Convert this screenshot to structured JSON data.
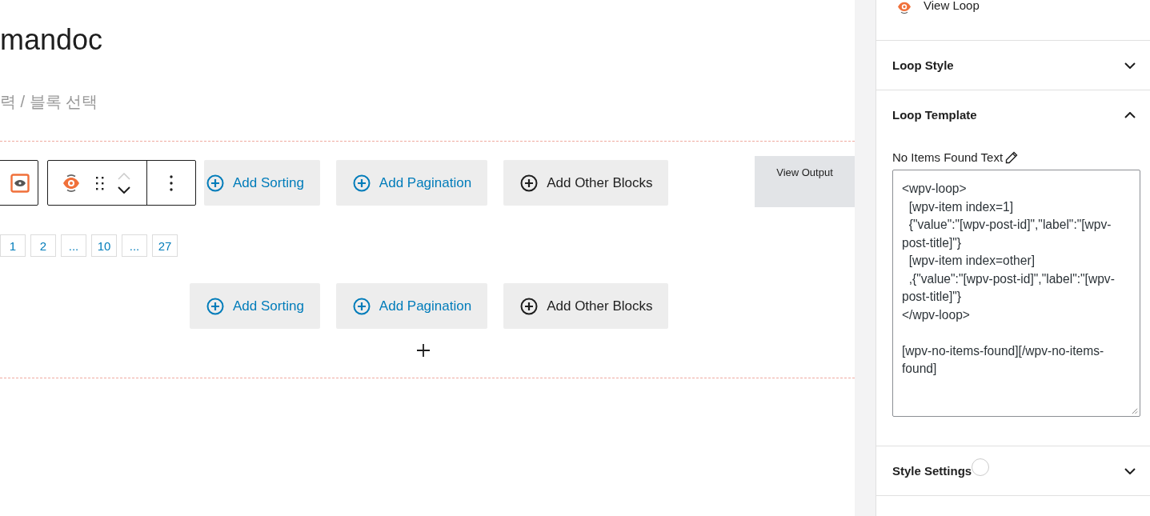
{
  "editor": {
    "title": "mandoc",
    "placeholder": "력 / 블록 선택",
    "top_buttons": [
      {
        "kind": "sorting",
        "label": "Add Sorting"
      },
      {
        "kind": "pagination",
        "label": "Add Pagination"
      },
      {
        "kind": "other",
        "label": "Add Other Blocks"
      }
    ],
    "pagination": [
      {
        "label": "1"
      },
      {
        "label": "2"
      },
      {
        "label": "..."
      },
      {
        "label": "10"
      },
      {
        "label": "..."
      },
      {
        "label": "27"
      }
    ],
    "bottom_buttons": [
      {
        "kind": "sorting",
        "label": "Add Sorting"
      },
      {
        "kind": "pagination",
        "label": "Add Pagination"
      },
      {
        "kind": "other",
        "label": "Add Other Blocks"
      }
    ],
    "view_output": "View Output"
  },
  "sidebar": {
    "view_loop": "View Loop",
    "panels": [
      {
        "title": "Loop Style",
        "expanded": false
      },
      {
        "title": "Loop Template",
        "expanded": true,
        "field_label": "No Items Found Text",
        "value": "<wpv-loop>\n  [wpv-item index=1]\n  {\"value\":\"[wpv-post-id]\",\"label\":\"[wpv-post-title]\"}\n  [wpv-item index=other]\n  ,{\"value\":\"[wpv-post-id]\",\"label\":\"[wpv-post-title]\"}\n</wpv-loop>\n\n[wpv-no-items-found][/wpv-no-items-found]"
      },
      {
        "title": "Style Settings",
        "expanded": false
      }
    ]
  }
}
